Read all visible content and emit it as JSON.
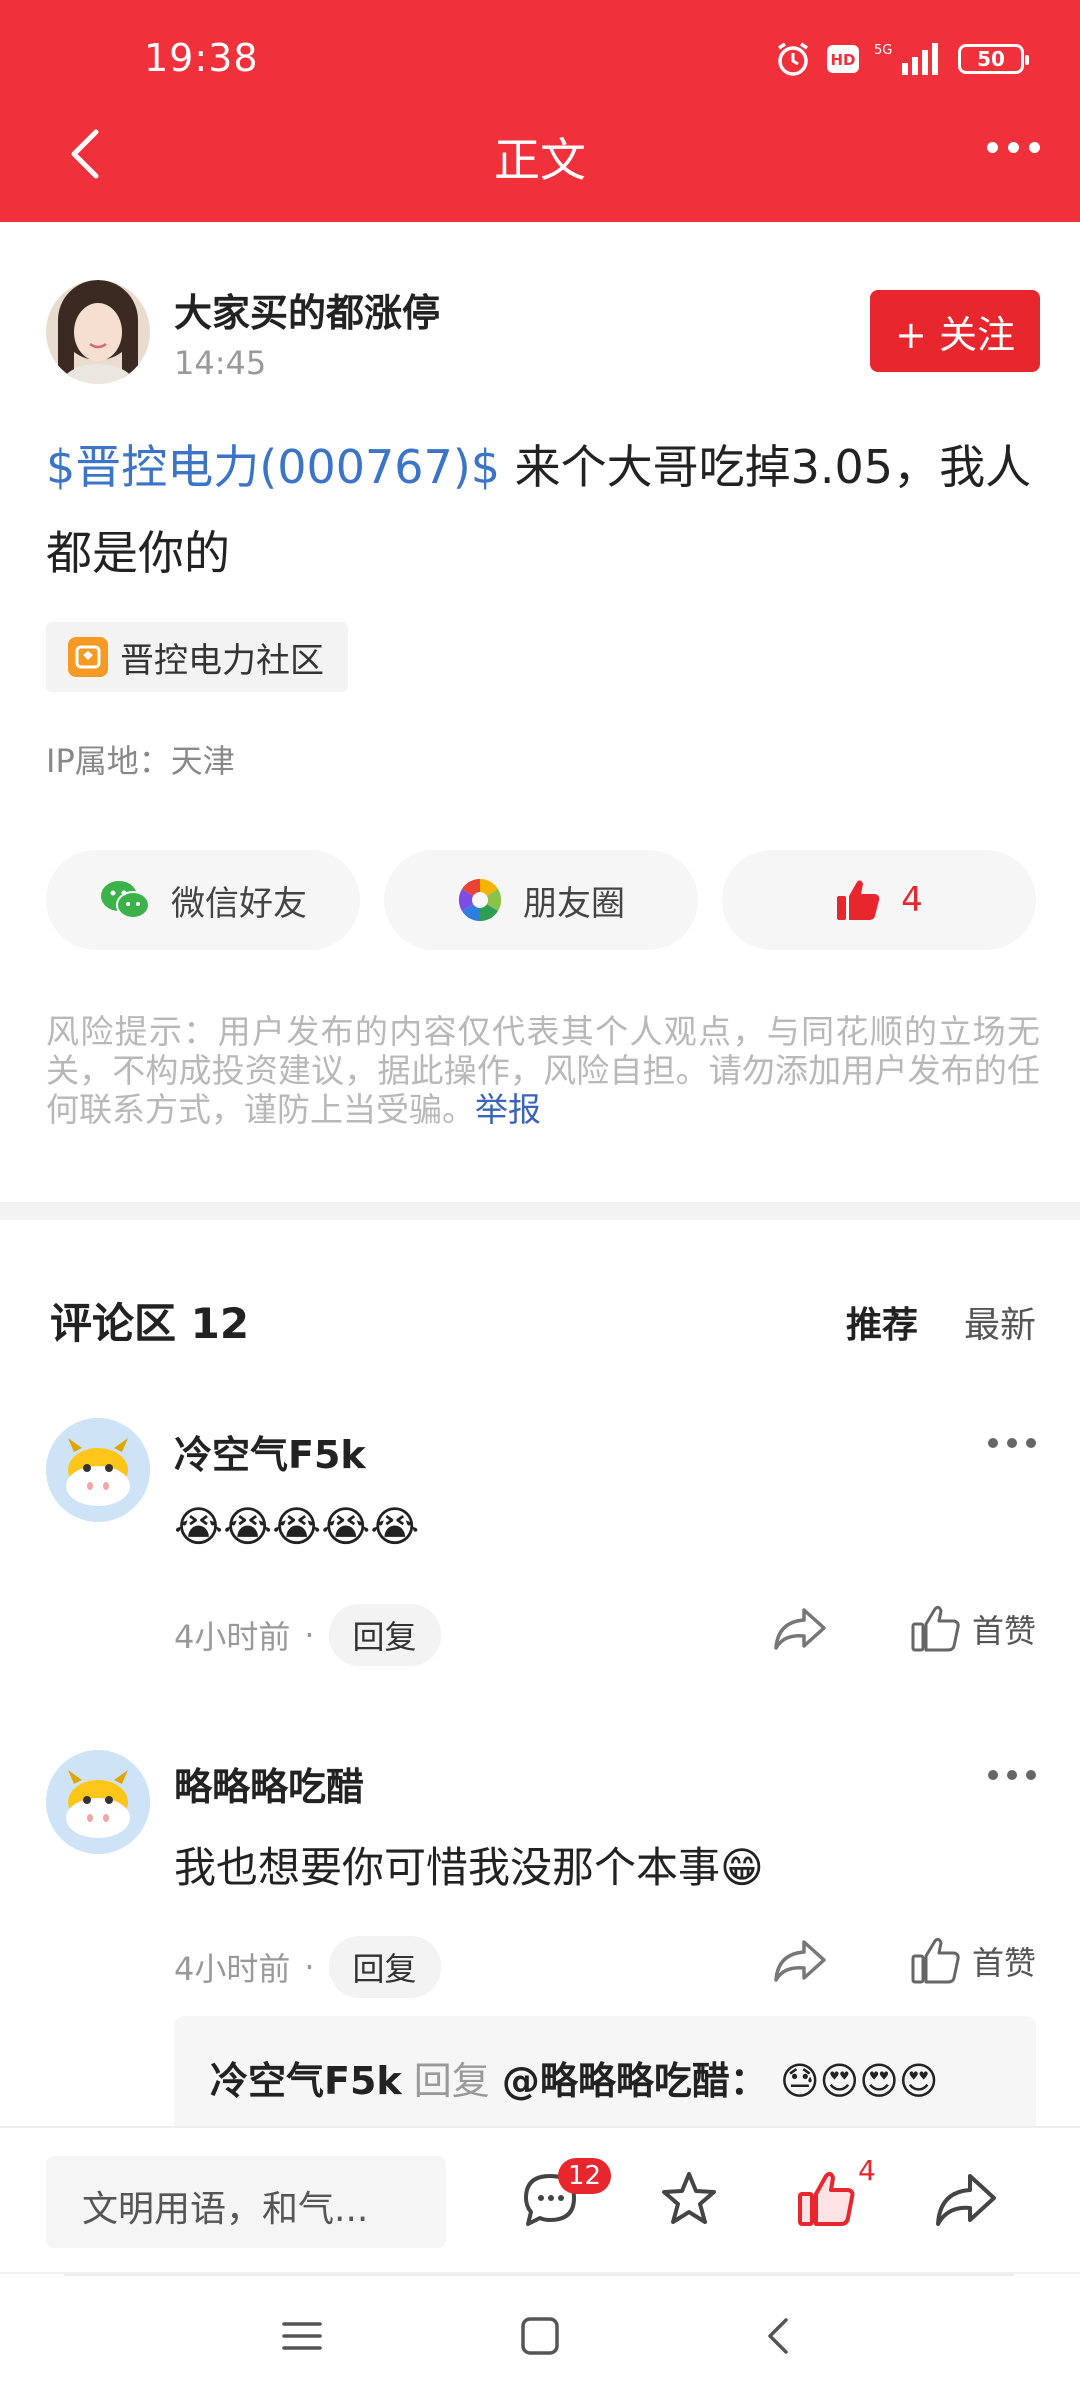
{
  "status_bar": {
    "time": "19:38",
    "battery": "50"
  },
  "nav": {
    "title": "正文"
  },
  "post": {
    "author_name": "大家买的都涨停",
    "time": "14:45",
    "follow_label": "+ 关注",
    "stock_tag": "$晋控电力(000767)$",
    "text": " 来个大哥吃掉3.05，我人都是你的",
    "community": "晋控电力社区",
    "ip_location": "IP属地：天津"
  },
  "share": {
    "wechat_label": "微信好友",
    "moments_label": "朋友圈",
    "like_count": "4"
  },
  "risk": {
    "text": "风险提示：用户发布的内容仅代表其个人观点，与同花顺的立场无关，不构成投资建议，据此操作，风险自担。请勿添加用户发布的任何联系方式，谨防上当受骗。",
    "report_label": "举报"
  },
  "comments_header": {
    "title": "评论区 12",
    "sort_recommend": "推荐",
    "sort_latest": "最新"
  },
  "comments": [
    {
      "name": "冷空气F5k",
      "text": "😭😭😭😭😭",
      "time": "4小时前",
      "reply_label": "回复",
      "like_label": "首赞"
    },
    {
      "name": "略略略吃醋",
      "text": "我也想要你可惜我没那个本事😁",
      "time": "4小时前",
      "reply_label": "回复",
      "like_label": "首赞"
    }
  ],
  "sub_reply": {
    "name": "冷空气F5k",
    "reply_word": "回复",
    "at": "@略略略吃醋：",
    "text": "😓😍😍😍"
  },
  "bottom_bar": {
    "input_placeholder": "文明用语，和气...",
    "comment_badge": "12",
    "like_count": "4"
  },
  "colors": {
    "brand_red": "#f0303b",
    "link_blue": "#3c74c8"
  }
}
